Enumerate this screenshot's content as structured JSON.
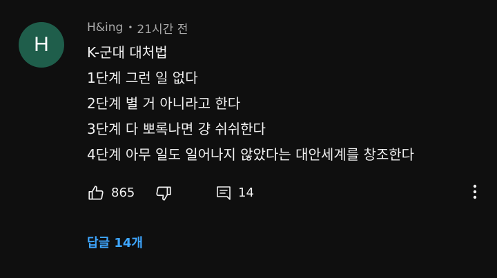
{
  "comment": {
    "avatar_letter": "H",
    "avatar_color": "#1f5e4b",
    "author": "H&ing",
    "separator": "•",
    "time": "21시간 전",
    "lines": [
      "K-군대 대처법",
      "1단계 그런 일 없다",
      "2단계 별 거 아니라고 한다",
      "3단계 다 뽀록나면 걍 쉬쉬한다",
      "4단계 아무 일도 일어나지 않았다는 대안세계를 창조한다"
    ],
    "actions": {
      "like_icon": "thumbs-up-icon",
      "like_count": "865",
      "dislike_icon": "thumbs-down-icon",
      "reply_icon": "comment-icon",
      "reply_count": "14",
      "more_icon": "more-vert-icon"
    },
    "replies_label": "답글 14개",
    "replies_color": "#3ea6ff"
  }
}
